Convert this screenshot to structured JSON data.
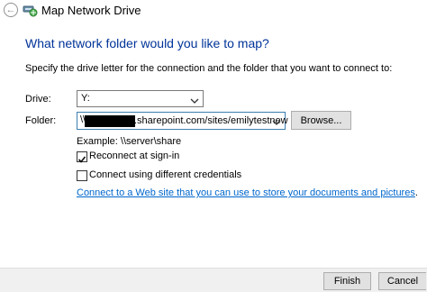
{
  "window": {
    "title": "Map Network Drive",
    "back_icon": "back-arrow-icon",
    "app_icon": "network-drive-icon"
  },
  "main": {
    "heading": "What network folder would you like to map?",
    "instruction": "Specify the drive letter for the connection and the folder that you want to connect to:"
  },
  "drive": {
    "label": "Drive:",
    "value": "Y:"
  },
  "folder": {
    "label": "Folder:",
    "value_prefix": "\\\\",
    "value_visible": ".sharepoint.com/sites/emilytestnew",
    "browse_label": "Browse..."
  },
  "example_text": "Example: \\\\server\\share",
  "reconnect": {
    "label": "Reconnect at sign-in",
    "checked": true
  },
  "credentials": {
    "label": "Connect using different credentials",
    "checked": false
  },
  "link_text": "Connect to a Web site that you can use to store your documents and pictures",
  "link_suffix": ".",
  "footer": {
    "finish_label": "Finish",
    "cancel_label": "Cancel"
  },
  "colors": {
    "heading": "#003399",
    "link": "#0066cc",
    "focus_border": "#3c7fb1"
  }
}
